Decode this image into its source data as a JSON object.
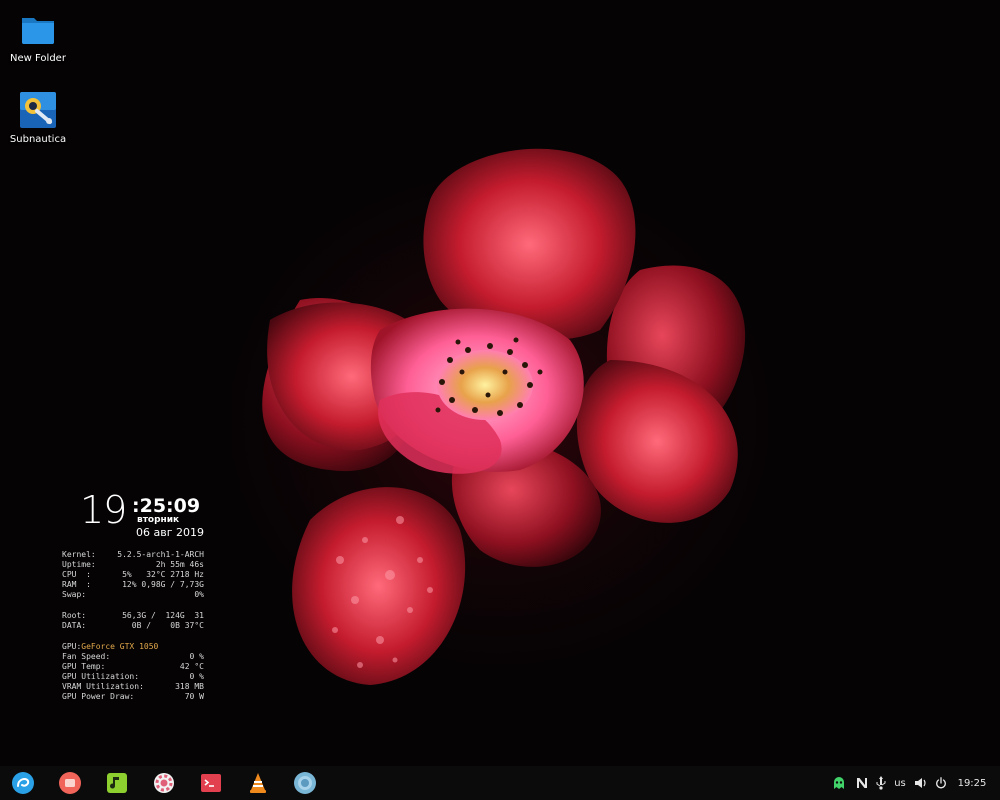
{
  "desktop": {
    "icons": [
      {
        "label": "New Folder",
        "icon": "folder-icon"
      },
      {
        "label": "Subnautica",
        "icon": "subnautica-game-icon"
      }
    ]
  },
  "conky": {
    "clock_hour": "19",
    "clock_min_sec": ":25:09",
    "day_of_week": "вторник",
    "date": "06 авг 2019",
    "system": [
      {
        "key": "Kernel:",
        "value": "5.2.5-arch1-1-ARCH"
      },
      {
        "key": "Uptime:",
        "value": "2h 55m 46s"
      },
      {
        "key": "CPU  :",
        "value": "5%   32°C 2718 Hz"
      },
      {
        "key": "RAM  :",
        "value": "12% 0,98G / 7,73G"
      },
      {
        "key": "Swap:",
        "value": "0%"
      }
    ],
    "disks": [
      {
        "key": "Root:",
        "value": "56,3G /  124G  31"
      },
      {
        "key": "DATA:",
        "value": "0B /    0B 37°C"
      }
    ],
    "gpu_label": "GPU:",
    "gpu_name": "GeForce GTX 1050",
    "gpu": [
      {
        "key": "Fan Speed:",
        "value": "0 %"
      },
      {
        "key": "GPU Temp:",
        "value": "42 °C"
      },
      {
        "key": "GPU Utilization:",
        "value": "0 %"
      },
      {
        "key": "VRAM Utilization:",
        "value": "318 MB"
      },
      {
        "key": "GPU Power Draw:",
        "value": "70 W"
      }
    ]
  },
  "taskbar": {
    "dock": [
      {
        "name": "launcher-icon",
        "color": "#2aa1e6"
      },
      {
        "name": "multitasking-view-icon",
        "color": "#f0645a"
      },
      {
        "name": "music-player-icon",
        "color": "#8ccf2f"
      },
      {
        "name": "settings-icon",
        "color": "#e0607a"
      },
      {
        "name": "terminal-icon",
        "color": "#e2404e"
      },
      {
        "name": "vlc-icon",
        "color": "#f18a1d"
      },
      {
        "name": "browser-icon",
        "color": "#7ab6d6"
      }
    ],
    "tray": {
      "keyboard_layout": "us",
      "time": "19:25"
    }
  },
  "colors": {
    "taskbar_bg": "#0b0b0c",
    "gpu_name": "#e2a84b",
    "accent_green": "#41d36a"
  }
}
